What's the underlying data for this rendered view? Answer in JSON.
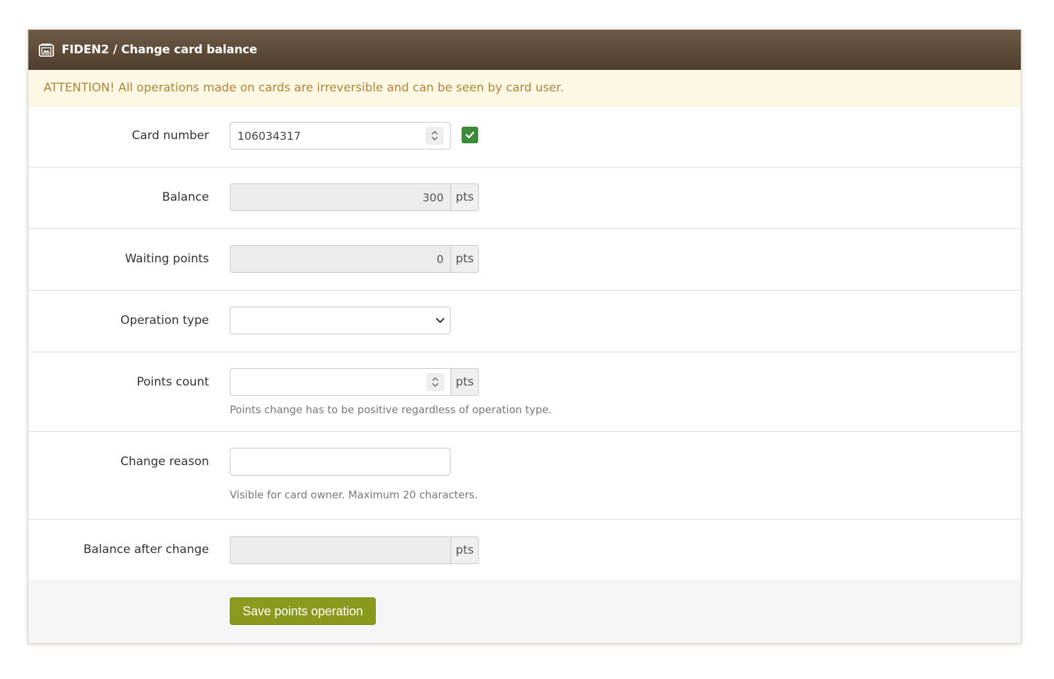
{
  "panel": {
    "title": "FIDEN2 / Change card balance"
  },
  "alert": {
    "text": "ATTENTION! All operations made on cards are irreversible and can be seen by card user."
  },
  "form": {
    "card_number": {
      "label": "Card number",
      "value": "106034317",
      "verified": true
    },
    "balance": {
      "label": "Balance",
      "value": "300",
      "unit": "pts"
    },
    "waiting_points": {
      "label": "Waiting points",
      "value": "0",
      "unit": "pts"
    },
    "operation_type": {
      "label": "Operation type",
      "selected": ""
    },
    "points_count": {
      "label": "Points count",
      "value": "",
      "unit": "pts",
      "help": "Points change has to be positive regardless of operation type."
    },
    "change_reason": {
      "label": "Change reason",
      "value": "",
      "help": "Visible for card owner. Maximum 20 characters."
    },
    "balance_after_change": {
      "label": "Balance after change",
      "value": "",
      "unit": "pts"
    }
  },
  "footer": {
    "save_label": "Save points operation"
  },
  "colors": {
    "header_bg": "#5c4937",
    "alert_bg": "#fcf8e3",
    "alert_text": "#b0833a",
    "save_button": "#8a9a1e",
    "verified_badge": "#3e8c3a"
  }
}
